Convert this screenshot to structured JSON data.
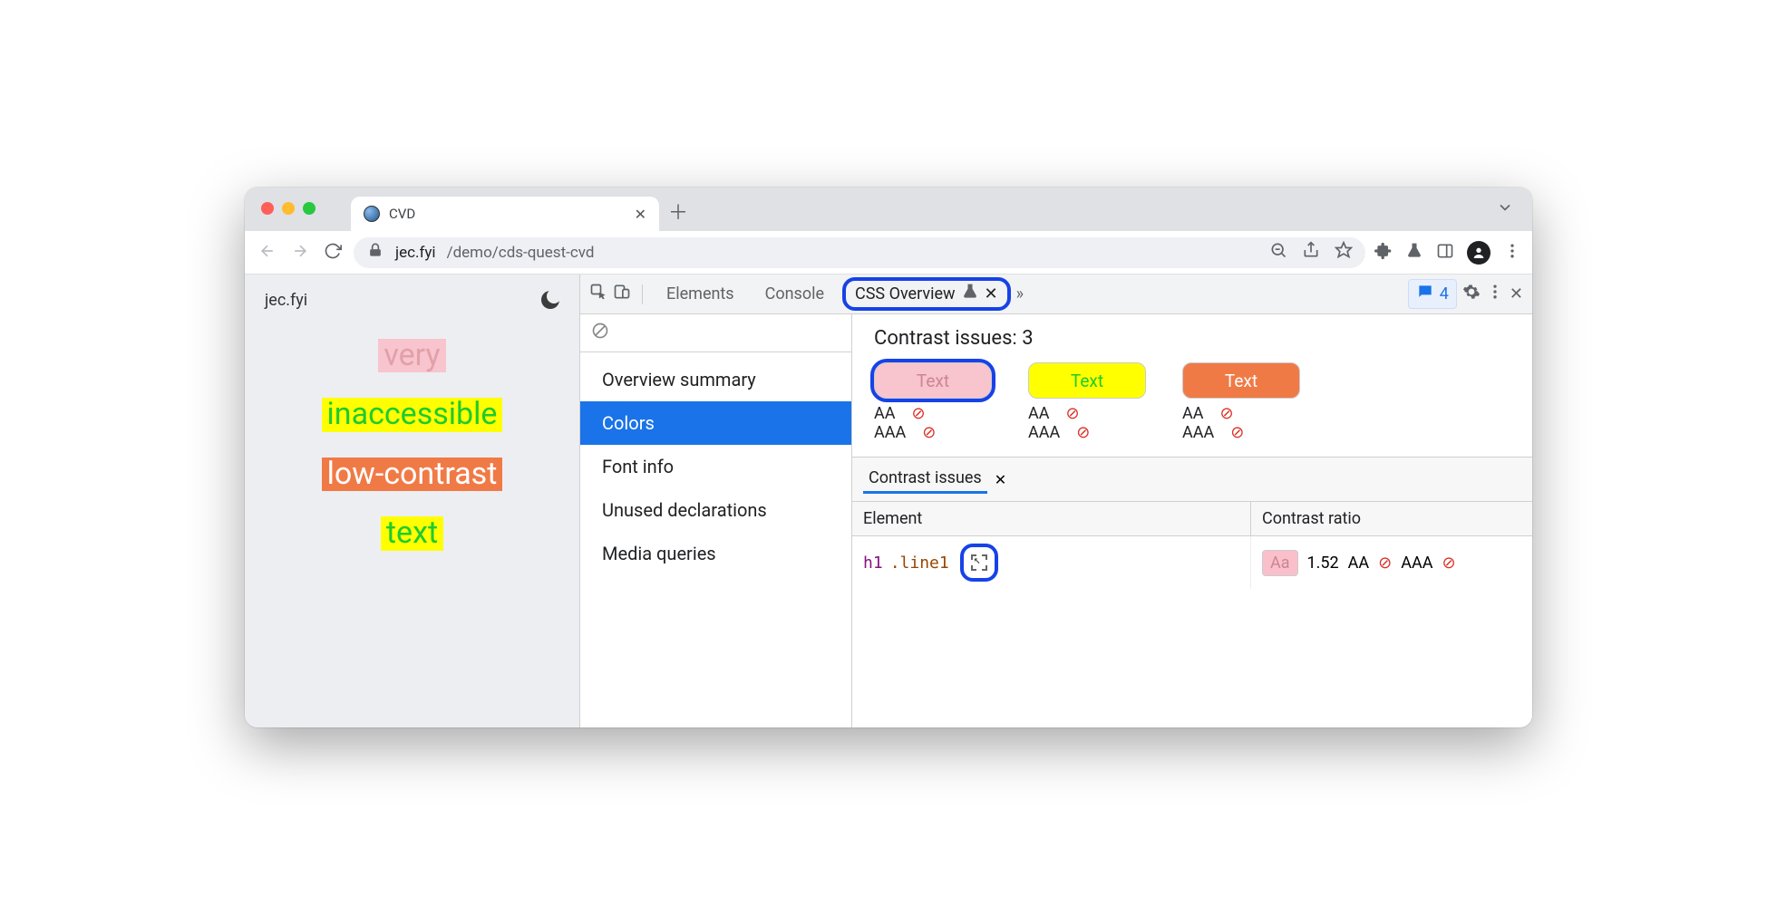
{
  "browser": {
    "tab_title": "CVD",
    "url_host": "jec.fyi",
    "url_path": "/demo/cds-quest-cvd",
    "traffic_colors": [
      "#ff5f57",
      "#febc2e",
      "#28c840"
    ]
  },
  "page": {
    "site_label": "jec.fyi",
    "words": [
      {
        "text": "very",
        "fg": "#e2a0aa",
        "bg": "#f8c4ce"
      },
      {
        "text": "inaccessible",
        "fg": "#1ecb2f",
        "bg": "#ffff00"
      },
      {
        "text": "low-contrast",
        "fg": "#ffffff",
        "bg": "#f07a46"
      },
      {
        "text": "text",
        "fg": "#1ecb2f",
        "bg": "#ffff00"
      }
    ]
  },
  "devtools": {
    "tabs": {
      "elements": "Elements",
      "console": "Console",
      "active": "CSS Overview"
    },
    "issues_count": "4",
    "sidebar": {
      "items": [
        "Overview summary",
        "Colors",
        "Font info",
        "Unused declarations",
        "Media queries"
      ],
      "active_index": 1
    },
    "contrast": {
      "heading_prefix": "Contrast issues:",
      "heading_count": "3",
      "swatch_label": "Text",
      "aa_label": "AA",
      "aaa_label": "AAA",
      "swatches": [
        {
          "fg": "#cc8592",
          "bg": "#f8c4ce",
          "highlight": true
        },
        {
          "fg": "#1ecb2f",
          "bg": "#ffff00",
          "highlight": false
        },
        {
          "fg": "#ffffff",
          "bg": "#f07a46",
          "highlight": false
        }
      ],
      "tab_label": "Contrast issues",
      "columns": {
        "element": "Element",
        "ratio": "Contrast ratio"
      },
      "row": {
        "tag": "h1",
        "cls": ".line1",
        "chip": "Aa",
        "ratio": "1.52",
        "aa": "AA",
        "aaa": "AAA"
      }
    }
  }
}
